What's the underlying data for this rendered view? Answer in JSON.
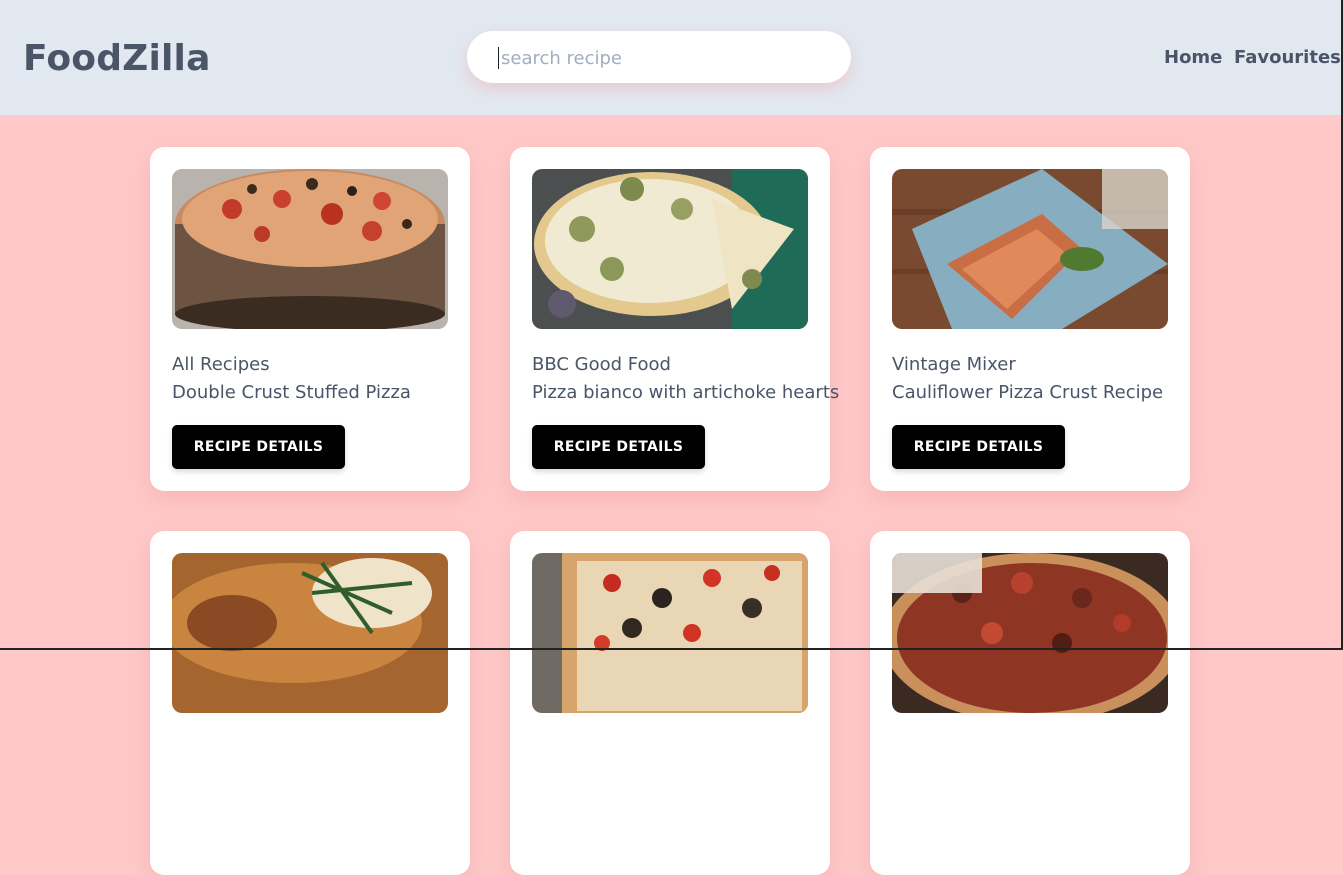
{
  "navbar": {
    "brand": "FoodZilla",
    "search_placeholder": "search recipe",
    "search_value": "",
    "links": [
      "Home",
      "Favourites"
    ]
  },
  "recipes": [
    {
      "source": "All Recipes",
      "title": "Double Crust Stuffed Pizza",
      "button": "RECIPE DETAILS"
    },
    {
      "source": "BBC Good Food",
      "title": "Pizza bianco with artichoke hearts",
      "button": "RECIPE DETAILS"
    },
    {
      "source": "Vintage Mixer",
      "title": "Cauliflower Pizza Crust Recipe",
      "button": "RECIPE DETAILS"
    },
    {
      "source": "",
      "title": "",
      "button": ""
    },
    {
      "source": "",
      "title": "",
      "button": ""
    },
    {
      "source": "",
      "title": "",
      "button": ""
    }
  ],
  "colors": {
    "navbar_bg": "#e2e8f0",
    "page_bg": "#ffc9c9",
    "text": "#4a5568",
    "button_bg": "#000000"
  }
}
